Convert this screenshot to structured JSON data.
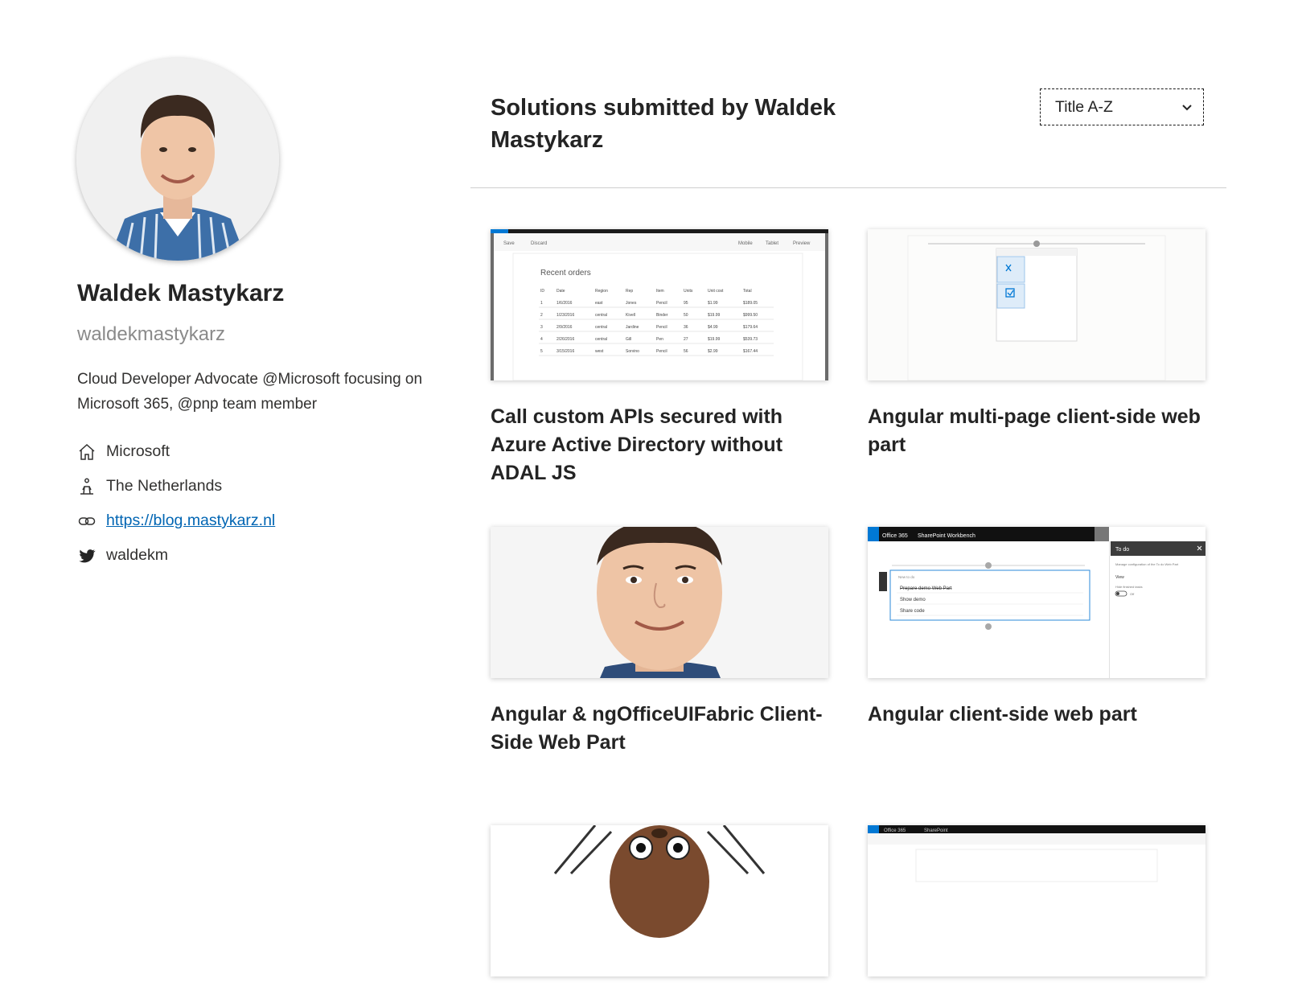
{
  "profile": {
    "name": "Waldek Mastykarz",
    "handle": "waldekmastykarz",
    "bio": "Cloud Developer Advocate @Microsoft focusing on Microsoft 365, @pnp team member",
    "company": "Microsoft",
    "location": "The Netherlands",
    "website": "https://blog.mastykarz.nl",
    "twitter": "waldekm",
    "icons": {
      "company": "home-icon",
      "location": "person-walking-icon",
      "website": "link-icon",
      "twitter": "twitter-icon"
    }
  },
  "main": {
    "title": "Solutions submitted by Waldek Mastykarz",
    "sort": {
      "selected": "Title A-Z"
    },
    "cards": [
      {
        "title": "Call custom APIs secured with Azure Active Directory without ADAL JS"
      },
      {
        "title": "Angular multi-page client-side web part"
      },
      {
        "title": "Angular & ngOfficeUIFabric Client-Side Web Part"
      },
      {
        "title": "Angular client-side web part"
      },
      {
        "title": ""
      },
      {
        "title": ""
      }
    ],
    "thumb_text": {
      "c1": {
        "save": "Save",
        "discard": "Discard",
        "mobile": "Mobile",
        "tablet": "Tablet",
        "preview": "Preview",
        "heading": "Recent orders",
        "headers": [
          "ID",
          "Date",
          "Region",
          "Rep",
          "Item",
          "Units",
          "Unit cost",
          "Total"
        ],
        "rows": [
          [
            "1",
            "1/6/2016",
            "east",
            "Jones",
            "Pencil",
            "95",
            "$1.99",
            "$189.05"
          ],
          [
            "2",
            "1/23/2016",
            "central",
            "Kivell",
            "Binder",
            "50",
            "$19.99",
            "$999.50"
          ],
          [
            "3",
            "2/9/2016",
            "central",
            "Jardine",
            "Pencil",
            "36",
            "$4.99",
            "$179.64"
          ],
          [
            "4",
            "2/26/2016",
            "central",
            "Gill",
            "Pen",
            "27",
            "$19.99",
            "$539.73"
          ],
          [
            "5",
            "3/15/2016",
            "west",
            "Sorvino",
            "Pencil",
            "56",
            "$2.99",
            "$167.44"
          ]
        ]
      },
      "c4": {
        "suite": "Office 365",
        "app": "SharePoint Workbench",
        "panel_title": "To do",
        "panel_desc": "Manage configuration of the To do Web Part",
        "panel_view": "View",
        "panel_hide": "Hide finished tasks",
        "panel_toggle": "Off",
        "new_task": "New to do",
        "tasks": [
          "Prepare demo Web Part",
          "Show demo",
          "Share code"
        ]
      },
      "c6": {
        "suite": "Office 365",
        "app": "SharePoint"
      }
    }
  }
}
